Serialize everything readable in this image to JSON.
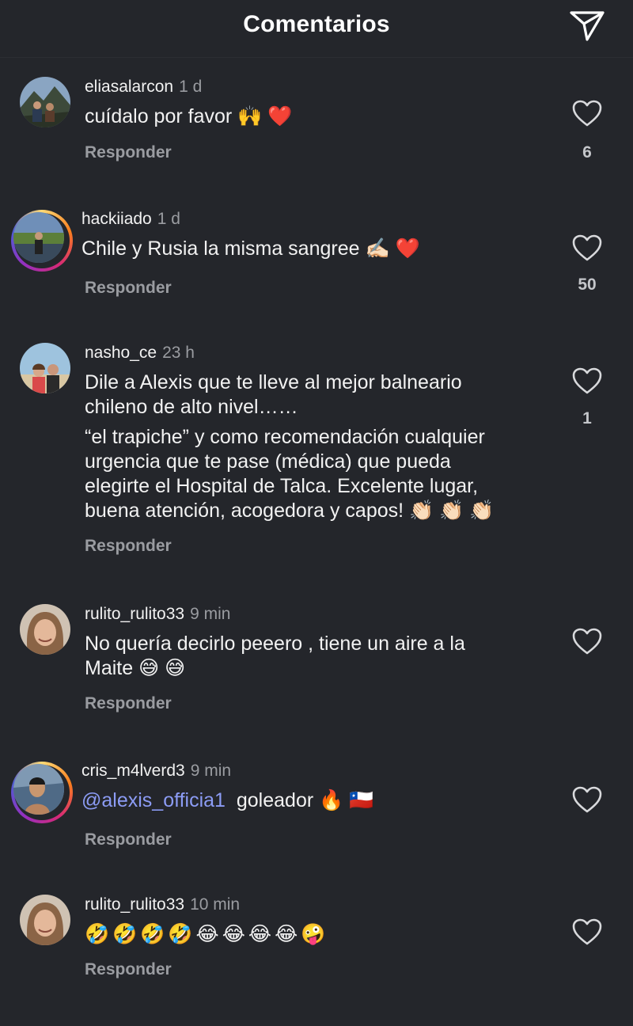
{
  "header": {
    "title": "Comentarios"
  },
  "comments": [
    {
      "username": "eliasalarcon",
      "time": "1 d",
      "lines": [
        "cuídalo por favor 🙌 ❤️"
      ],
      "reply": "Responder",
      "likes": "6"
    },
    {
      "username": "hackiiado",
      "time": "1 d",
      "lines": [
        "Chile y Rusia la misma sangree ✍🏻 ❤️"
      ],
      "reply": "Responder",
      "likes": "50"
    },
    {
      "username": "nasho_ce",
      "time": "23 h",
      "lines": [
        "Dile a Alexis que te lleve al mejor balneario",
        "chileno de alto nivel……",
        "“el trapiche” y como recomendación cualquier",
        "urgencia que te pase (médica) que pueda",
        "elegirte el Hospital de Talca. Excelente lugar,",
        "buena atención, acogedora y capos! 👏🏻 👏🏻 👏🏻"
      ],
      "reply": "Responder",
      "likes": "1"
    },
    {
      "username": "rulito_rulito33",
      "time": "9 min",
      "lines": [
        "No quería decirlo peeero , tiene un aire a la",
        "Maite 😅 😅"
      ],
      "reply": "Responder"
    },
    {
      "username": "cris_m4lverd3",
      "time": "9 min",
      "mention": "@alexis_officia1",
      "lines": [
        "goleador 🔥 🇨🇱"
      ],
      "reply": "Responder"
    },
    {
      "username": "rulito_rulito33",
      "time": "10 min",
      "lines": [
        "🤣🤣🤣🤣😂😂😂😂🤪"
      ],
      "reply": "Responder"
    }
  ]
}
